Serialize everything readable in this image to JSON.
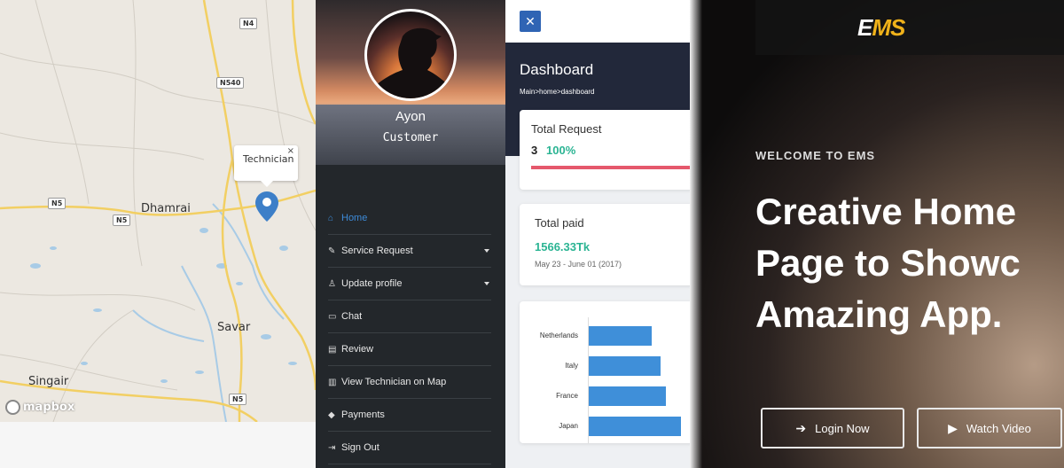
{
  "map": {
    "places": [
      "Dhamrai",
      "Savar",
      "Singair"
    ],
    "road_shields": [
      "N4",
      "N540",
      "N5",
      "N5",
      "N5"
    ],
    "popup_label": "Technician",
    "popup_close": "×",
    "attribution": "mapbox",
    "pin_icon": "map-marker-icon"
  },
  "sidebar": {
    "user_name": "Ayon",
    "user_role": "Customer",
    "menu": [
      {
        "label": "Home",
        "icon": "⌂",
        "icon_name": "home-icon",
        "active": true
      },
      {
        "label": "Service Request",
        "icon": "✎",
        "icon_name": "wrench-icon",
        "dropdown": true
      },
      {
        "label": "Update profile",
        "icon": "♙",
        "icon_name": "user-icon",
        "dropdown": true
      },
      {
        "label": "Chat",
        "icon": "▭",
        "icon_name": "chat-icon"
      },
      {
        "label": "Review",
        "icon": "▤",
        "icon_name": "review-icon"
      },
      {
        "label": "View Technician on Map",
        "icon": "▥",
        "icon_name": "map-icon"
      },
      {
        "label": "Payments",
        "icon": "◆",
        "icon_name": "tag-icon"
      },
      {
        "label": "Sign Out",
        "icon": "⇥",
        "icon_name": "sign-out-icon"
      }
    ],
    "active_color": "#3d8bd9"
  },
  "dashboard": {
    "close_label": "✕",
    "title": "Dashboard",
    "breadcrumb": "Main>home>dashboard",
    "total_request": {
      "label": "Total Request",
      "count": "3",
      "percent": "100%",
      "progress": 100
    },
    "total_paid": {
      "label": "Total paid",
      "value": "1566.33Tk",
      "date_range": "May 23 - June 01 (2017)"
    },
    "accent_green": "#2bb493",
    "accent_red": "#e5586c"
  },
  "chart_data": {
    "type": "bar",
    "orientation": "horizontal",
    "categories": [
      "Netherlands",
      "Italy",
      "France",
      "Japan"
    ],
    "values": [
      60,
      69,
      74,
      88
    ],
    "title": "",
    "xlabel": "",
    "ylabel": ""
  },
  "hero": {
    "logo_text": "EMS",
    "welcome": "WELCOME TO EMS",
    "headline_lines": [
      "Creative Home",
      "Page to Showc",
      "Amazing App."
    ],
    "login_label": "Login Now",
    "watch_label": "Watch Video",
    "logo_accent": "#f0b21a"
  }
}
